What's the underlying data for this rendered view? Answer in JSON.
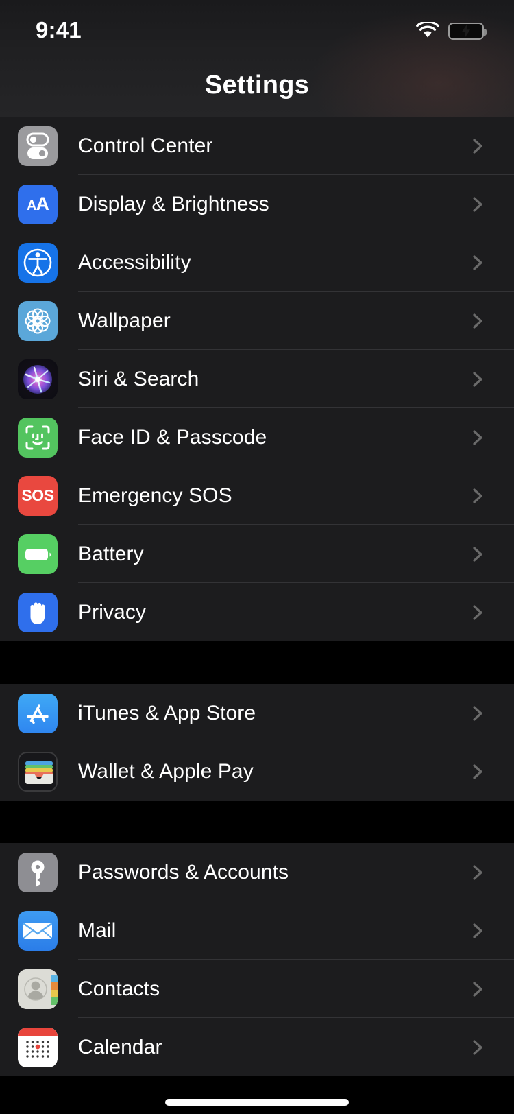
{
  "status_bar": {
    "time": "9:41",
    "wifi_icon": "wifi-icon",
    "battery_icon": "battery-charging-icon",
    "battery_color": "#4cd662"
  },
  "header": {
    "title": "Settings"
  },
  "colors": {
    "row_background": "#1c1c1e",
    "page_background": "#000000",
    "separator": "#333336",
    "label_text": "#ffffff",
    "chevron": "#6a6a6a"
  },
  "groups": [
    {
      "rows": [
        {
          "label": "Control Center",
          "icon": "control-center-icon",
          "icon_color": "#9b9b9e",
          "chevron": "chevron-right-icon"
        },
        {
          "label": "Display & Brightness",
          "icon": "display-brightness-icon",
          "icon_color": "#2f6fec",
          "chevron": "chevron-right-icon"
        },
        {
          "label": "Accessibility",
          "icon": "accessibility-icon",
          "icon_color": "#1673e8",
          "chevron": "chevron-right-icon"
        },
        {
          "label": "Wallpaper",
          "icon": "wallpaper-icon",
          "icon_color": "#5ba7d9",
          "chevron": "chevron-right-icon"
        },
        {
          "label": "Siri & Search",
          "icon": "siri-icon",
          "icon_color": "#15121b",
          "chevron": "chevron-right-icon"
        },
        {
          "label": "Face ID & Passcode",
          "icon": "face-id-icon",
          "icon_color": "#53c45f",
          "chevron": "chevron-right-icon"
        },
        {
          "label": "Emergency SOS",
          "icon": "emergency-sos-icon",
          "icon_color": "#e9483f",
          "chevron": "chevron-right-icon"
        },
        {
          "label": "Battery",
          "icon": "battery-icon",
          "icon_color": "#56cf63",
          "chevron": "chevron-right-icon"
        },
        {
          "label": "Privacy",
          "icon": "privacy-hand-icon",
          "icon_color": "#2f6fec",
          "chevron": "chevron-right-icon"
        }
      ]
    },
    {
      "rows": [
        {
          "label": "iTunes & App Store",
          "icon": "app-store-icon",
          "icon_color": "#3fa9f5",
          "chevron": "chevron-right-icon"
        },
        {
          "label": "Wallet & Apple Pay",
          "icon": "wallet-icon",
          "icon_color": "#17171a",
          "chevron": "chevron-right-icon"
        }
      ]
    },
    {
      "rows": [
        {
          "label": "Passwords & Accounts",
          "icon": "key-icon",
          "icon_color": "#8e8e93",
          "chevron": "chevron-right-icon"
        },
        {
          "label": "Mail",
          "icon": "mail-envelope-icon",
          "icon_color": "#3e9bf2",
          "chevron": "chevron-right-icon"
        },
        {
          "label": "Contacts",
          "icon": "contacts-icon",
          "icon_color": "#dcdcd6",
          "chevron": "chevron-right-icon"
        },
        {
          "label": "Calendar",
          "icon": "calendar-icon",
          "icon_color": "#ffffff",
          "chevron": "chevron-right-icon"
        }
      ]
    }
  ],
  "display_icon_text": {
    "big": "A",
    "small": "A"
  },
  "sos_icon_text": "SOS",
  "home_indicator": "home-indicator"
}
